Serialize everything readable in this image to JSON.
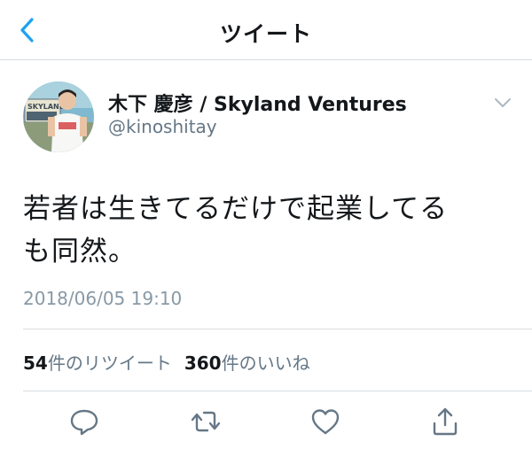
{
  "header": {
    "title": "ツイート"
  },
  "author": {
    "name": "木下 慶彦 / Skyland Ventures",
    "handle": "@kinoshitay",
    "avatar_sign_text": "SKYLAND"
  },
  "tweet": {
    "line1": "若者は生きてるだけで起業してる",
    "line2": "も同然。",
    "timestamp": "2018/06/05 19:10"
  },
  "stats": {
    "retweet_count": "54",
    "retweet_label": "件のリツイート",
    "like_count": "360",
    "like_label": "件のいいね"
  },
  "colors": {
    "accent": "#1da1f2",
    "muted": "#657786",
    "divider": "#d8dde1"
  },
  "icons": [
    "chevron-left-icon",
    "chevron-down-icon",
    "reply-icon",
    "retweet-icon",
    "heart-icon",
    "share-icon"
  ]
}
